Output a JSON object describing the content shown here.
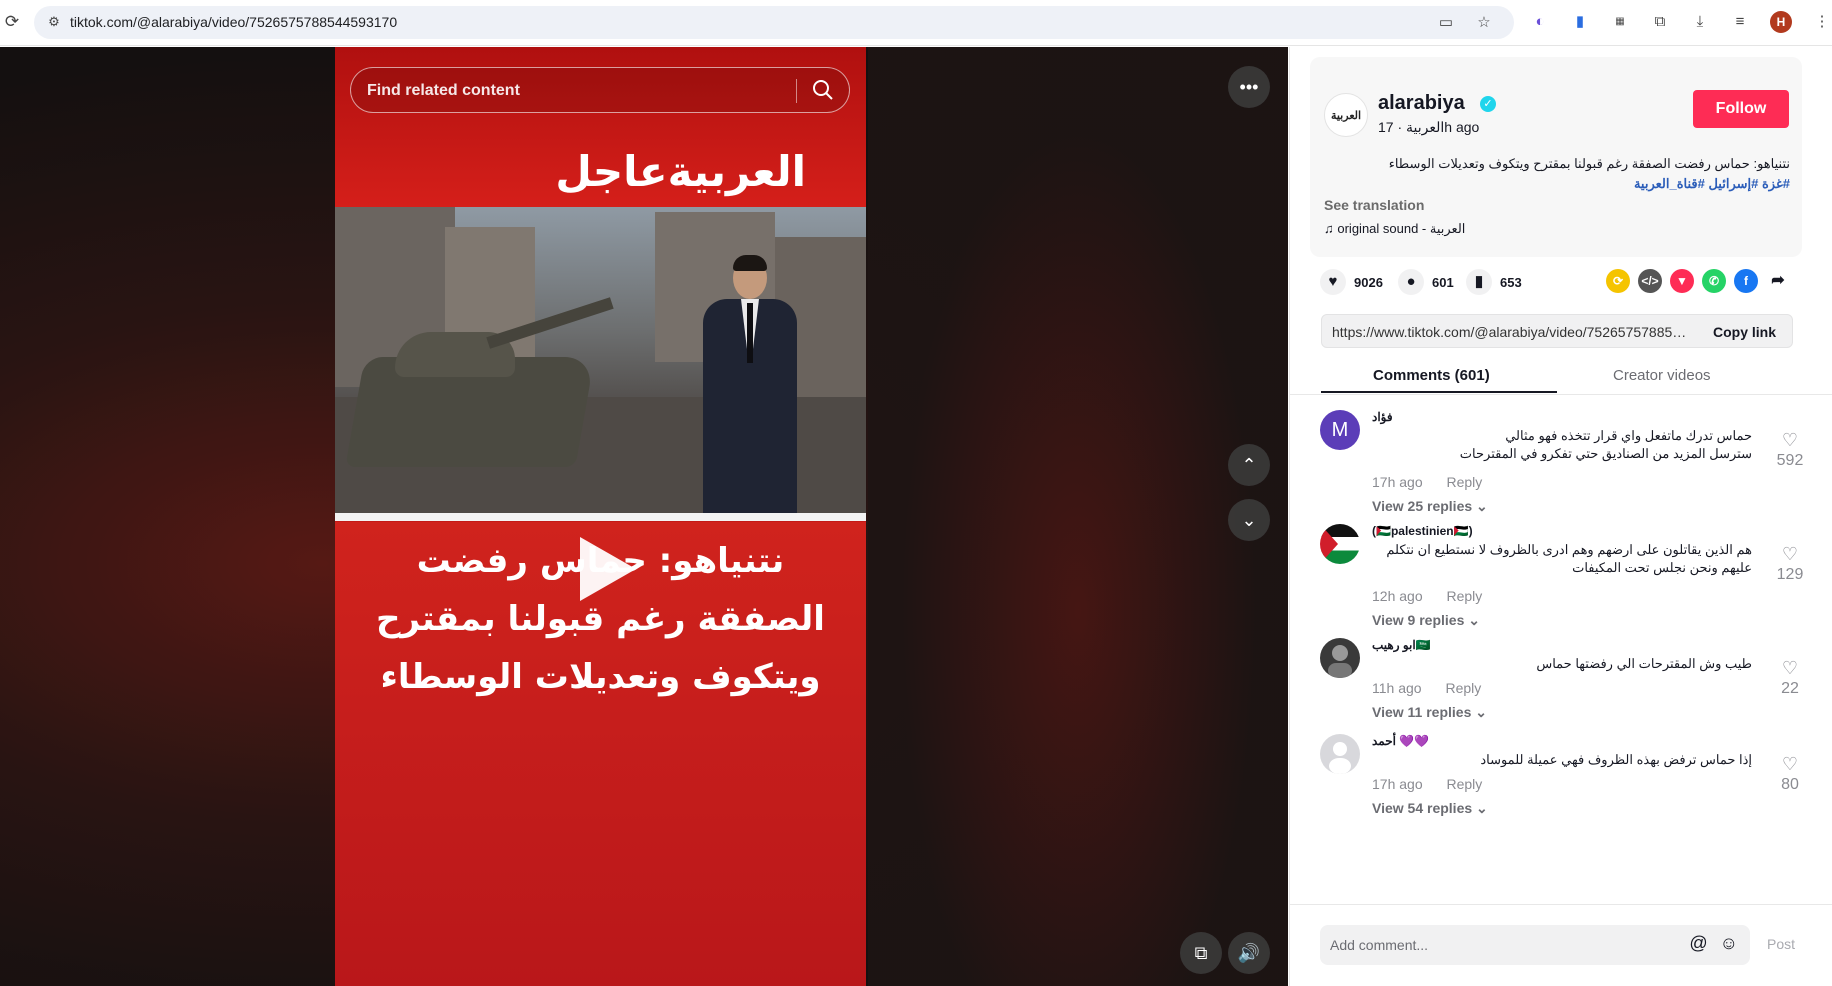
{
  "browser": {
    "url": "tiktok.com/@alarabiya/video/7526575788544593170",
    "profile_initial": "H"
  },
  "video": {
    "search_placeholder": "Find related content",
    "logo_text": "العربيةعاجل",
    "headline": "نتنياهو: حماس رفضت الصفقة رغم قبولنا بمقترح ويتكوف وتعديلات الوسطاء"
  },
  "post": {
    "channel_logo_text": "العربية",
    "handle": "alarabiya",
    "subline": "العربية · 17h ago",
    "follow_label": "Follow",
    "caption": "نتنياهو: حماس رفضت الصفقة رغم قبولنا بمقترح ويتكوف وتعديلات الوسطاء",
    "hashtags": "#غزة #إسرائيل #قناة_العربية",
    "see_translation": "See translation",
    "sound": "original sound - العربية"
  },
  "actions": {
    "likes": "9026",
    "comments": "601",
    "saves": "653"
  },
  "share": {
    "link": "https://www.tiktok.com/@alarabiya/video/7526575788544593170",
    "copy_label": "Copy link"
  },
  "tabs": {
    "comments": "Comments (601)",
    "creator_videos": "Creator videos"
  },
  "comments": [
    {
      "avatar_letter": "M",
      "user": "فؤاد",
      "text": "حماس تدرك ماتفعل واي قرار تتخذه فهو مثالي\nسترسل المزيد من الصناديق حتي تفكرو في المقترحات",
      "time": "17h ago",
      "reply": "Reply",
      "view_replies": "View 25 replies",
      "likes": "592"
    },
    {
      "avatar_letter": "",
      "user": "(🇵🇸palestinien🇵🇸)",
      "text": "هم الذين يقاتلون على ارضهم وهم ادرى بالظروف لا نستطيع ان نتكلم\nعليهم ونحن نجلس تحت المكيفات",
      "time": "12h ago",
      "reply": "Reply",
      "view_replies": "View 9 replies",
      "likes": "129"
    },
    {
      "avatar_letter": "",
      "user": "ابو رهيب🇸🇦",
      "text": "طيب وش المقترحات الي رفضتها حماس",
      "time": "11h ago",
      "reply": "Reply",
      "view_replies": "View 11 replies",
      "likes": "22"
    },
    {
      "avatar_letter": "",
      "user": "أحمد 💜💜",
      "text": "إذا حماس ترفض بهذه الظروف فهي عميلة للموساد",
      "time": "17h ago",
      "reply": "Reply",
      "view_replies": "View 54 replies",
      "likes": "80"
    }
  ],
  "compose": {
    "placeholder": "Add comment...",
    "post_label": "Post"
  },
  "colors": {
    "follow": "#fe2c55",
    "hashtag": "#2b5db9",
    "video_red": "#c41a17"
  }
}
